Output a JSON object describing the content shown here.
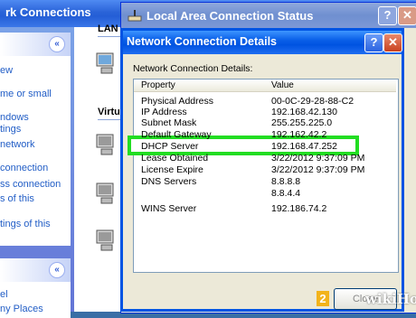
{
  "background_window": {
    "title": "rk Connections",
    "taskpane": {
      "section1_links": [
        "ew",
        "me or small",
        "ndows",
        "tings",
        "network",
        "connection",
        "ss connection",
        "s of this",
        "tings of this"
      ],
      "section2_links": [
        "el",
        "ny Places"
      ]
    },
    "groups": {
      "lan": "LAN",
      "virtual": "Virtu"
    }
  },
  "status_window": {
    "title": "Local Area Connection Status",
    "help_label": "?",
    "close_label": "✕"
  },
  "details_dialog": {
    "title": "Network Connection Details",
    "help_label": "?",
    "close_label": "✕",
    "list_label": "Network Connection Details:",
    "columns": {
      "property": "Property",
      "value": "Value"
    },
    "rows": [
      {
        "property": "Physical Address",
        "value": "00-0C-29-28-88-C2"
      },
      {
        "property": "IP Address",
        "value": "192.168.42.130"
      },
      {
        "property": "Subnet Mask",
        "value": "255.255.225.0"
      },
      {
        "property": "Default Gateway",
        "value": "192.162.42.2"
      },
      {
        "property": "DHCP Server",
        "value": "192.168.47.252"
      },
      {
        "property": "Lease Obtained",
        "value": "3/22/2012 9:37:09 PM"
      },
      {
        "property": "License Expire",
        "value": "3/22/2012 9:37:09 PM"
      },
      {
        "property": "DNS Servers",
        "value": "8.8.8.8"
      },
      {
        "property": "",
        "value": "8.8.4.4"
      },
      {
        "property": "WINS Server",
        "value": "192.186.74.2"
      }
    ],
    "close_button_label": "Close",
    "step_badge": "2"
  },
  "watermark": "wikiHow"
}
